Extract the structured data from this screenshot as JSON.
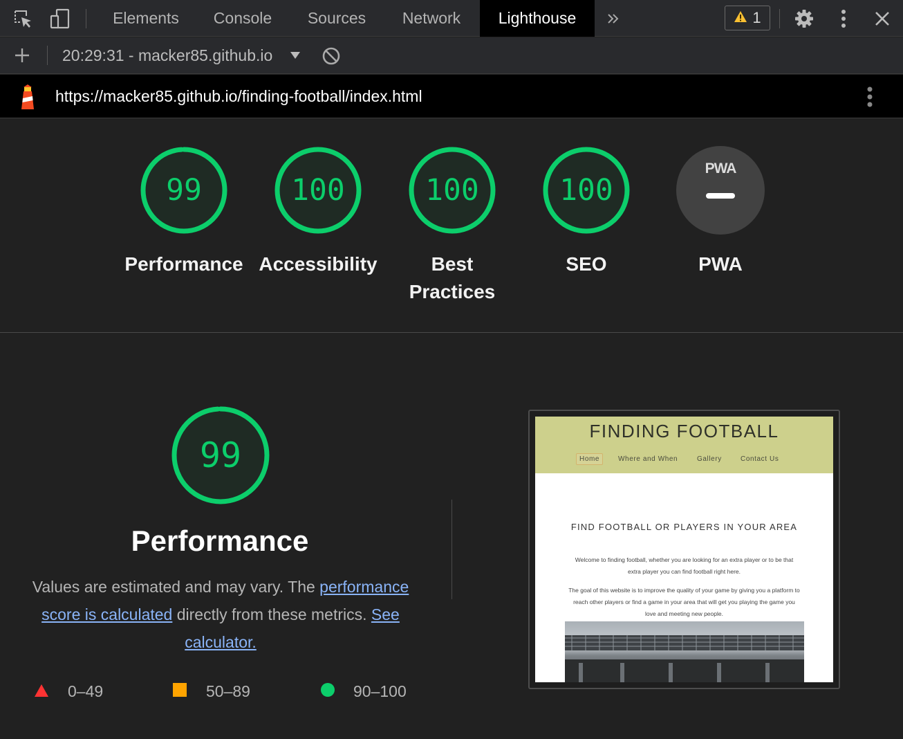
{
  "devtools": {
    "tabs": [
      {
        "label": "Elements"
      },
      {
        "label": "Console"
      },
      {
        "label": "Sources"
      },
      {
        "label": "Network"
      },
      {
        "label": "Lighthouse",
        "active": true
      }
    ],
    "more_tabs_icon": "double-chevron-right-icon",
    "warning_count": "1",
    "icons": [
      "inspect-element-icon",
      "device-toolbar-icon",
      "warning-icon",
      "gear-icon",
      "more-vertical-icon",
      "close-icon"
    ]
  },
  "toolbar2": {
    "session_label": "20:29:31 - macker85.github.io",
    "icons": [
      "plus-icon",
      "dropdown-triangle-icon",
      "clear-circle-icon"
    ]
  },
  "urlbar": {
    "url": "https://macker85.github.io/finding-football/index.html",
    "icons": [
      "lighthouse-logo-icon",
      "more-vertical-icon"
    ]
  },
  "gauges": [
    {
      "score": "99",
      "label": "Performance",
      "value": 0.99
    },
    {
      "score": "100",
      "label": "Accessibility",
      "value": 1.0
    },
    {
      "score": "100",
      "label": "Best Practices",
      "value": 1.0
    },
    {
      "score": "100",
      "label": "SEO",
      "value": 1.0
    },
    {
      "label": "PWA",
      "badge_text": "PWA"
    }
  ],
  "performance": {
    "score": "99",
    "value": 0.99,
    "title": "Performance",
    "desc_prefix": "Values are estimated and may vary. The ",
    "desc_link1": "performance score is calculated",
    "desc_middle": " directly from these metrics. ",
    "desc_link2": "See calculator."
  },
  "legend": [
    {
      "range": "0–49",
      "shape": "triangle",
      "color": "#ff3333"
    },
    {
      "range": "50–89",
      "shape": "square",
      "color": "#ffa400"
    },
    {
      "range": "90–100",
      "shape": "circle",
      "color": "#0cce6b"
    }
  ],
  "colors": {
    "pass": "#0cce6b",
    "link": "#8ab4f8",
    "background": "#212121"
  },
  "thumbnail": {
    "site_title": "FINDING FOOTBALL",
    "nav": [
      "Home",
      "Where and When",
      "Gallery",
      "Contact Us"
    ],
    "heading": "FIND FOOTBALL OR PLAYERS IN YOUR AREA",
    "para1": "Welcome to finding football, whether you are looking for an extra player or to be that extra player you can find football right here.",
    "para2": "The goal of this website is to improve the quality of your game by giving you a platform to reach other players or find a game in your area that will get you playing the game you love and meeting new people."
  }
}
